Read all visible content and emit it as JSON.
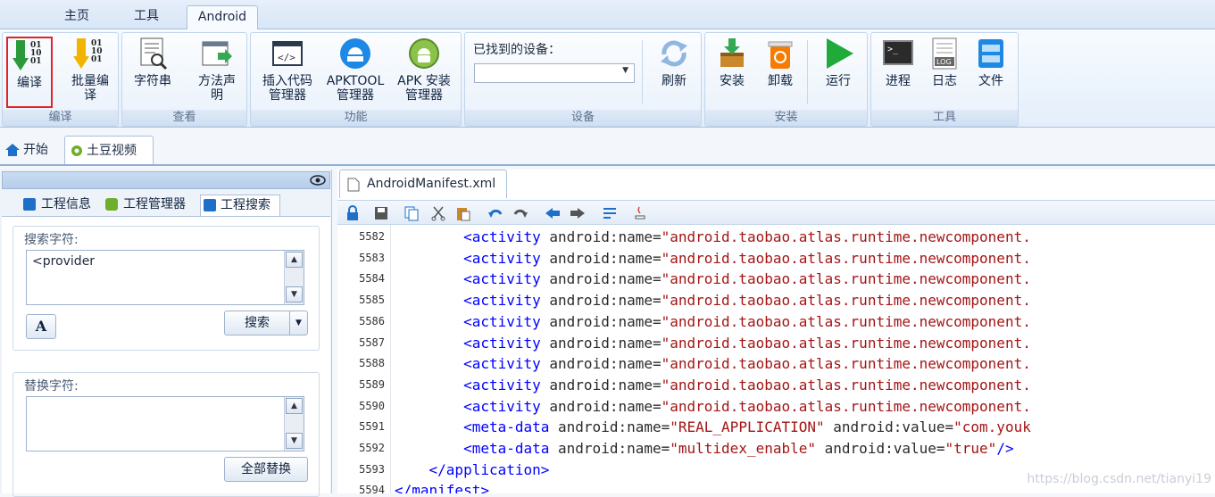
{
  "ribbon_tabs": [
    "主页",
    "工具",
    "Android"
  ],
  "groups": {
    "compile": {
      "label": "编译",
      "buttons": [
        "编译",
        "批量编\n译"
      ]
    },
    "view": {
      "label": "查看",
      "buttons": [
        "字符串",
        "方法声\n明"
      ]
    },
    "func": {
      "label": "功能",
      "buttons": [
        "插入代码\n管理器",
        "APKTOOL\n管理器",
        "APK 安装\n管理器"
      ]
    },
    "device": {
      "label": "设备",
      "found_label": "已找到的设备：",
      "refresh": "刷新"
    },
    "install": {
      "label": "安装",
      "buttons": [
        "安装",
        "卸载",
        "运行"
      ]
    },
    "tools": {
      "label": "工具",
      "buttons": [
        "进程",
        "日志",
        "文件"
      ]
    }
  },
  "doc_tabs": [
    "开始",
    "土豆视频"
  ],
  "panel": {
    "tabs": [
      "工程信息",
      "工程管理器",
      "工程搜索"
    ],
    "search_label": "搜索字符:",
    "search_value": "<provider",
    "search_button": "搜索",
    "replace_label": "替换字符:",
    "replace_value": "",
    "replace_all_button": "全部替换"
  },
  "editor": {
    "file_tab": "AndroidManifest.xml",
    "lines": [
      {
        "no": "5582",
        "indent": 8,
        "tag": "<activity",
        "rest": [
          [
            "attr",
            " android:name="
          ],
          [
            "val",
            "\"android.taobao.atlas.runtime.newcomponent."
          ]
        ]
      },
      {
        "no": "5583",
        "indent": 8,
        "tag": "<activity",
        "rest": [
          [
            "attr",
            " android:name="
          ],
          [
            "val",
            "\"android.taobao.atlas.runtime.newcomponent."
          ]
        ]
      },
      {
        "no": "5584",
        "indent": 8,
        "tag": "<activity",
        "rest": [
          [
            "attr",
            " android:name="
          ],
          [
            "val",
            "\"android.taobao.atlas.runtime.newcomponent."
          ]
        ]
      },
      {
        "no": "5585",
        "indent": 8,
        "tag": "<activity",
        "rest": [
          [
            "attr",
            " android:name="
          ],
          [
            "val",
            "\"android.taobao.atlas.runtime.newcomponent."
          ]
        ]
      },
      {
        "no": "5586",
        "indent": 8,
        "tag": "<activity",
        "rest": [
          [
            "attr",
            " android:name="
          ],
          [
            "val",
            "\"android.taobao.atlas.runtime.newcomponent."
          ]
        ]
      },
      {
        "no": "5587",
        "indent": 8,
        "tag": "<activity",
        "rest": [
          [
            "attr",
            " android:name="
          ],
          [
            "val",
            "\"android.taobao.atlas.runtime.newcomponent."
          ]
        ]
      },
      {
        "no": "5588",
        "indent": 8,
        "tag": "<activity",
        "rest": [
          [
            "attr",
            " android:name="
          ],
          [
            "val",
            "\"android.taobao.atlas.runtime.newcomponent."
          ]
        ]
      },
      {
        "no": "5589",
        "indent": 8,
        "tag": "<activity",
        "rest": [
          [
            "attr",
            " android:name="
          ],
          [
            "val",
            "\"android.taobao.atlas.runtime.newcomponent."
          ]
        ]
      },
      {
        "no": "5590",
        "indent": 8,
        "tag": "<activity",
        "rest": [
          [
            "attr",
            " android:name="
          ],
          [
            "val",
            "\"android.taobao.atlas.runtime.newcomponent."
          ]
        ]
      },
      {
        "no": "5591",
        "indent": 8,
        "tag": "<meta-data",
        "rest": [
          [
            "attr",
            " android:name="
          ],
          [
            "val",
            "\"REAL_APPLICATION\""
          ],
          [
            "attr",
            " android:value="
          ],
          [
            "val",
            "\"com.youk"
          ]
        ]
      },
      {
        "no": "5592",
        "indent": 8,
        "tag": "<meta-data",
        "rest": [
          [
            "attr",
            " android:name="
          ],
          [
            "val",
            "\"multidex_enable\""
          ],
          [
            "attr",
            " android:value="
          ],
          [
            "val",
            "\"true\""
          ],
          [
            "tag",
            "/>"
          ]
        ]
      },
      {
        "no": "5593",
        "indent": 4,
        "tag": "</application>",
        "rest": []
      },
      {
        "no": "5594",
        "indent": 0,
        "tag": "</manifest>",
        "rest": []
      }
    ]
  },
  "watermark": "https://blog.csdn.net/tianyi19"
}
